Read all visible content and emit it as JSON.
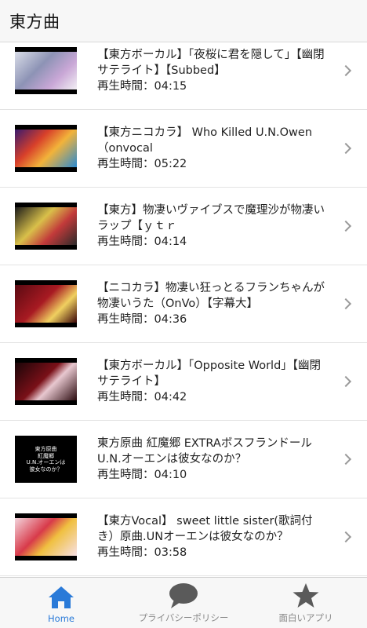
{
  "header": {
    "title": "東方曲"
  },
  "videos": [
    {
      "title": "【東方ボーカル】「夜桜に君を隠して」【幽閉サテライト】【Subbed】",
      "duration": "再生時間：04:15",
      "thumb": "linear-gradient(135deg,#d9dde8 0%,#8d93b5 40%,#c9a7d6 70%,#f2f0f4 100%)"
    },
    {
      "title": "【東方ニコカラ】 Who Killed U.N.Owen（onvocal",
      "duration": "再生時間：05:22",
      "thumb": "linear-gradient(135deg,#3a1a6e 0%,#d8402a 35%,#f2b33a 60%,#2a8ad0 100%)"
    },
    {
      "title": "【東方】物凄いヴァイブスで魔理沙が物凄いラップ【ｙｔｒ",
      "duration": "再生時間：04:14",
      "thumb": "linear-gradient(135deg,#1a1a1a 0%,#d9c04a 40%,#c23a3a 65%,#2a2a2a 100%)"
    },
    {
      "title": "【ニコカラ】物凄い狂っとるフランちゃんが物凄いうた（OnVo）【字幕大】",
      "duration": "再生時間：04:36",
      "thumb": "linear-gradient(135deg,#5a0a12 0%,#a81a22 45%,#f0d060 70%,#3a0508 100%)"
    },
    {
      "title": "【東方ボーカル】「Opposite World」【幽閉サテライト】",
      "duration": "再生時間：04:42",
      "thumb": "linear-gradient(135deg,#1a0508 0%,#7a1018 45%,#e8c8d0 60%,#2a0a0e 100%)"
    },
    {
      "title": "東方原曲 紅魔郷 EXTRAボスフランドール　U.N.オーエンは彼女なのか？",
      "duration": "再生時間：04:10",
      "thumb": "#000000",
      "thumb_text": "東方原曲\n紅魔郷\nU.N.オーエンは\n彼女なのか？"
    },
    {
      "title": "【東方Vocal】 sweet little sister(歌詞付き）原曲.UNオーエンは彼女なのか？",
      "duration": "再生時間：03:58",
      "thumb": "linear-gradient(135deg,#f3d4dc 0%,#d83a4a 40%,#f0c040 60%,#f7e0e6 100%)"
    }
  ],
  "tabs": [
    {
      "label": "Home",
      "icon": "home-icon",
      "active": true
    },
    {
      "label": "プライバシーポリシー",
      "icon": "speech-bubble-icon",
      "active": false
    },
    {
      "label": "面白いアプリ",
      "icon": "star-icon",
      "active": false
    }
  ],
  "colors": {
    "accent": "#2a7ad8",
    "inactive": "#5a5a5a"
  }
}
